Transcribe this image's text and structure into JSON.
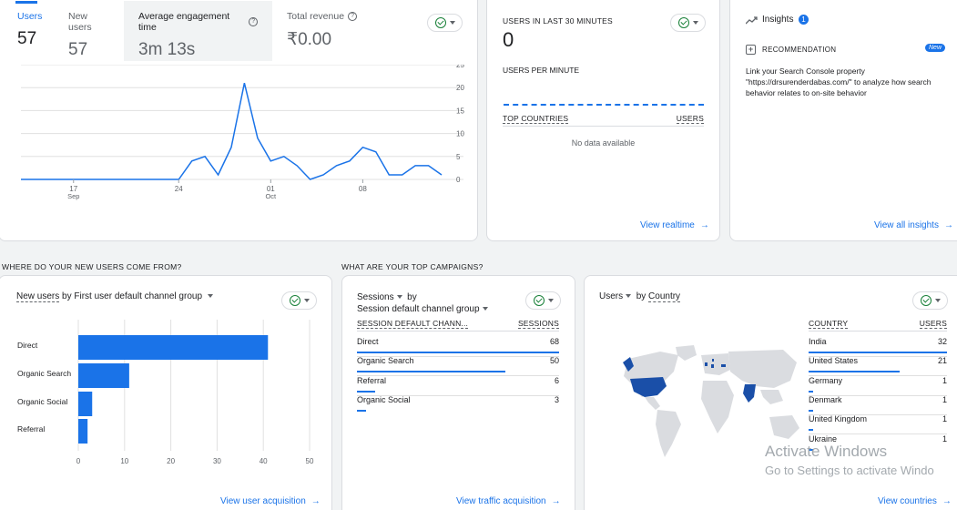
{
  "overview": {
    "tabs": [
      {
        "label": "Users",
        "value": "57"
      },
      {
        "label": "New users",
        "value": "57"
      },
      {
        "label": "Average engagement time",
        "value": "3m 13s"
      },
      {
        "label": "Total revenue",
        "value": "₹0.00"
      }
    ],
    "y_ticks": [
      "25",
      "20",
      "15",
      "10",
      "5",
      "0"
    ],
    "x_ticks": [
      {
        "day": "17",
        "month": "Sep"
      },
      {
        "day": "24",
        "month": ""
      },
      {
        "day": "01",
        "month": "Oct"
      },
      {
        "day": "08",
        "month": ""
      }
    ]
  },
  "chart_data": {
    "type": "line",
    "series": [
      {
        "values": [
          0,
          0,
          0,
          0,
          0,
          0,
          0,
          0,
          0,
          0,
          0,
          0,
          0,
          4,
          5,
          1,
          7,
          21,
          9,
          4,
          5,
          3,
          0,
          1,
          3,
          4,
          7,
          6,
          1,
          1,
          3,
          3,
          1
        ]
      }
    ],
    "ylim": [
      0,
      25
    ],
    "grid": true,
    "color": "#1a73e8"
  },
  "realtime": {
    "title": "USERS IN LAST 30 MINUTES",
    "value": "0",
    "per_minute_label": "USERS PER MINUTE",
    "col_country": "TOP COUNTRIES",
    "col_users": "USERS",
    "empty": "No data available",
    "link": "View realtime"
  },
  "insights": {
    "title": "Insights",
    "badge": "1",
    "rec_label": "RECOMMENDATION",
    "new_badge": "New",
    "text": "Link your Search Console property \"https://drsurenderdabas.com/\" to analyze how search behavior relates to on-site behavior",
    "link": "View all insights"
  },
  "acquisition": {
    "section": "WHERE DO YOUR NEW USERS COME FROM?",
    "heading_metric": "New users",
    "heading_rest": "by First user default channel group",
    "categories": [
      "Direct",
      "Organic Search",
      "Organic Social",
      "Referral"
    ],
    "values": [
      41,
      11,
      3,
      2
    ],
    "x_ticks": [
      "0",
      "10",
      "20",
      "30",
      "40",
      "50"
    ],
    "link": "View user acquisition"
  },
  "campaigns": {
    "section": "WHAT ARE YOUR TOP CAMPAIGNS?",
    "heading_metric": "Sessions",
    "heading_by": "by",
    "heading_dim": "Session default channel group",
    "col_name": "SESSION DEFAULT CHANN...",
    "col_value": "SESSIONS",
    "rows": [
      {
        "name": "Direct",
        "value": "68",
        "frac": 1.0
      },
      {
        "name": "Organic Search",
        "value": "50",
        "frac": 0.735
      },
      {
        "name": "Referral",
        "value": "6",
        "frac": 0.088
      },
      {
        "name": "Organic Social",
        "value": "3",
        "frac": 0.044
      }
    ],
    "link": "View traffic acquisition"
  },
  "countries": {
    "heading_metric": "Users",
    "heading_by": "by",
    "heading_dim": "Country",
    "col_name": "COUNTRY",
    "col_value": "USERS",
    "rows": [
      {
        "name": "India",
        "value": "32",
        "frac": 1.0
      },
      {
        "name": "United States",
        "value": "21",
        "frac": 0.656
      },
      {
        "name": "Germany",
        "value": "1",
        "frac": 0.031
      },
      {
        "name": "Denmark",
        "value": "1",
        "frac": 0.031
      },
      {
        "name": "United Kingdom",
        "value": "1",
        "frac": 0.031
      },
      {
        "name": "Ukraine",
        "value": "1",
        "frac": 0.031
      }
    ],
    "link": "View countries"
  },
  "watermark": {
    "line1": "Activate Windows",
    "line2": "Go to Settings to activate Windo"
  },
  "colors": {
    "accent": "#1a73e8",
    "map_highlight": "#1a4fa8",
    "map_base": "#dadce0"
  }
}
